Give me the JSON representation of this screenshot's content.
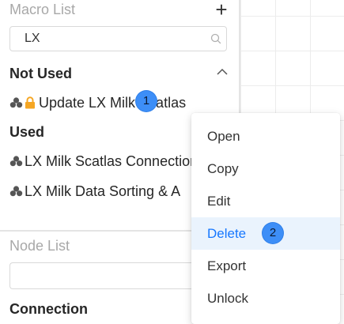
{
  "macro_list": {
    "title": "Macro List",
    "search_value": "LX",
    "not_used_title": "Not Used",
    "not_used_items": [
      {
        "label": "Update LX Milk Scatlas",
        "icons": [
          "clubs-icon",
          "lock-icon"
        ]
      }
    ],
    "used_title": "Used",
    "used_items": [
      {
        "label": "LX Milk Scatlas Connection",
        "icons": [
          "clubs-icon"
        ]
      },
      {
        "label": "LX Milk Data Sorting & A",
        "icons": [
          "clubs-icon"
        ]
      }
    ]
  },
  "node_list": {
    "title": "Node List",
    "input_value": "",
    "connection_title": "Connection"
  },
  "context_menu": {
    "items": [
      "Open",
      "Copy",
      "Edit",
      "Delete",
      "Export",
      "Unlock"
    ],
    "active_item": "Delete"
  },
  "annotations": {
    "badge_1": "1",
    "badge_2": "2"
  },
  "colors": {
    "accent": "#1677ff",
    "menu_active_bg": "#eaf3fd",
    "lock": "#f5a623",
    "badge": "#3d8ef7"
  }
}
